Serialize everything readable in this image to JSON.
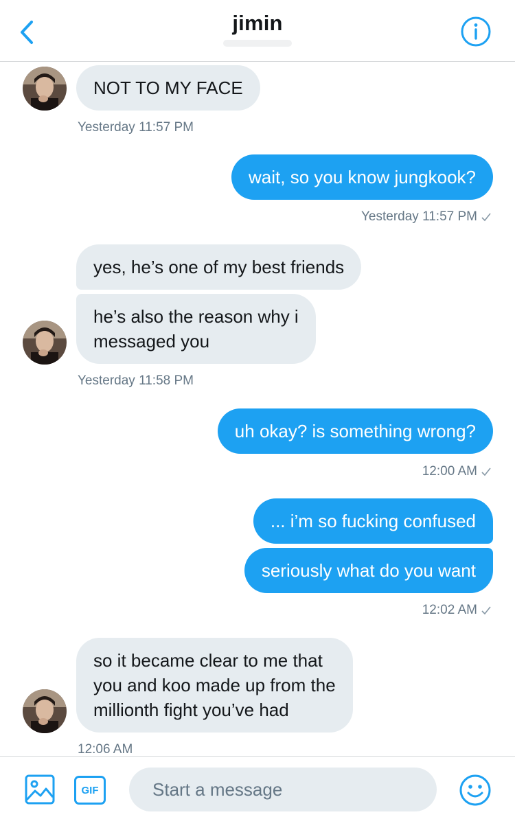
{
  "header": {
    "title": "jimin",
    "back_icon": "chevron-left-icon",
    "info_icon": "info-icon",
    "accent": "#1da1f2"
  },
  "messages": [
    {
      "side": "in",
      "text": "NOT TO MY FACE"
    },
    {
      "side": "in",
      "timestamp": "Yesterday 11:57 PM"
    },
    {
      "side": "out",
      "text": "wait, so you know jungkook?",
      "timestamp": "Yesterday 11:57 PM"
    },
    {
      "side": "in",
      "texts": [
        "yes, he’s one of my best friends",
        "he’s also the reason why i\nmessaged you"
      ],
      "timestamp": "Yesterday 11:58 PM"
    },
    {
      "side": "out",
      "text": "uh okay? is something wrong?",
      "timestamp": "12:00 AM"
    },
    {
      "side": "out",
      "texts": [
        "... i’m so fucking confused",
        "seriously what do you want"
      ],
      "timestamp": "12:02 AM"
    },
    {
      "side": "in",
      "text": "so it became clear to me that\nyou and koo made up from the\nmillionth fight you’ve had",
      "timestamp": "12:06 AM"
    }
  ],
  "composer": {
    "placeholder": "Start a message",
    "gif_label": "GIF",
    "media_icon": "image-icon",
    "emoji_icon": "emoji-icon"
  },
  "colors": {
    "incoming_bubble": "#e6ecf0",
    "outgoing_bubble": "#1da1f2",
    "timestamp": "#657786"
  }
}
